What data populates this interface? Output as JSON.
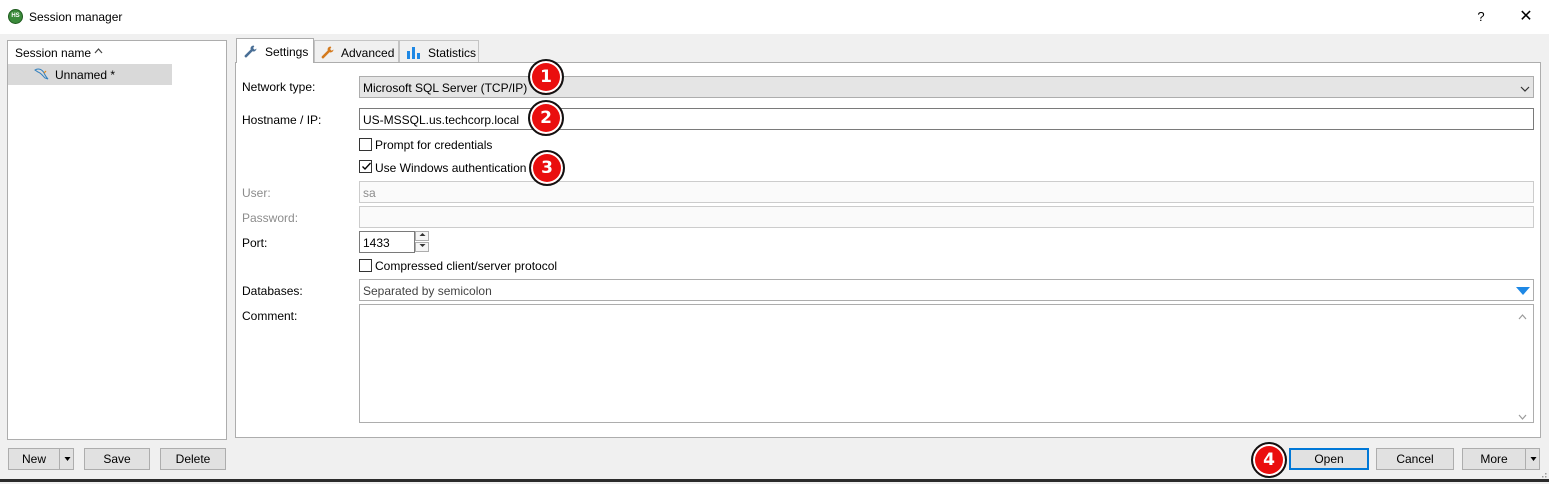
{
  "window": {
    "title": "Session manager",
    "app_icon": "HS",
    "help": "?",
    "close": "✕"
  },
  "sessions": {
    "header": "Session name",
    "sort_icon": "^",
    "items": [
      {
        "label": "Unnamed *",
        "icon": "dolphin-icon"
      }
    ]
  },
  "tabs": [
    {
      "label": "Settings",
      "icon": "wrench-icon",
      "active": true
    },
    {
      "label": "Advanced",
      "icon": "wrench-icon",
      "active": false
    },
    {
      "label": "Statistics",
      "icon": "bar-chart-icon",
      "active": false
    }
  ],
  "settings": {
    "network_type": {
      "label": "Network type:",
      "value": "Microsoft SQL Server (TCP/IP)"
    },
    "hostname": {
      "label": "Hostname / IP:",
      "value": "US-MSSQL.us.techcorp.local"
    },
    "prompt_credentials": {
      "label": "Prompt for credentials",
      "checked": false
    },
    "windows_auth": {
      "label": "Use Windows authentication",
      "checked": true
    },
    "user": {
      "label": "User:",
      "value": "sa"
    },
    "password": {
      "label": "Password:",
      "value": ""
    },
    "port": {
      "label": "Port:",
      "value": "1433"
    },
    "compressed": {
      "label": "Compressed client/server protocol",
      "checked": false
    },
    "databases": {
      "label": "Databases:",
      "placeholder": "Separated by semicolon"
    },
    "comment": {
      "label": "Comment:",
      "value": ""
    }
  },
  "buttons": {
    "new": "New",
    "save": "Save",
    "delete": "Delete",
    "open": "Open",
    "cancel": "Cancel",
    "more": "More"
  },
  "annotations": [
    "1",
    "2",
    "3",
    "4"
  ],
  "colors": {
    "badge": "#ea0e0e",
    "accent": "#0078d7",
    "dropdown_arrow": "#1e88e5"
  }
}
